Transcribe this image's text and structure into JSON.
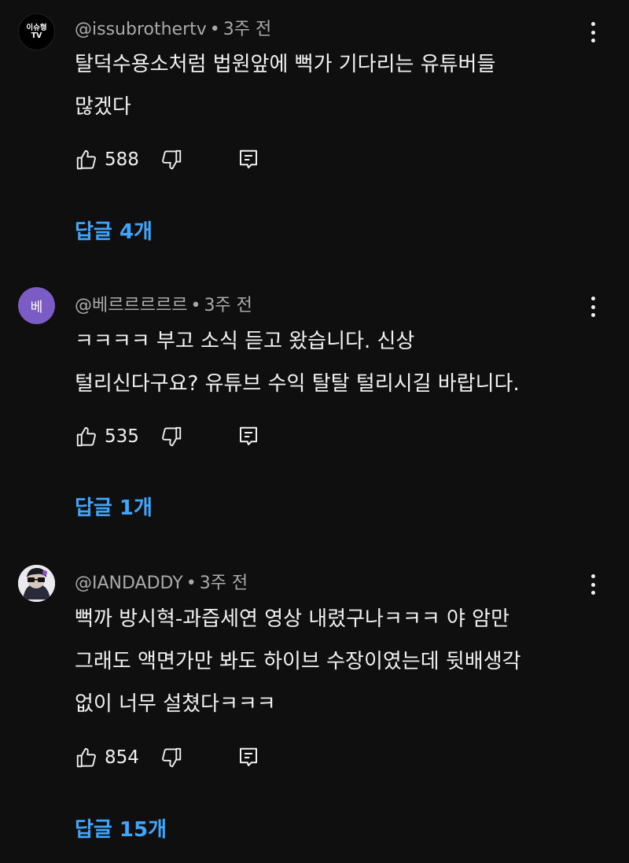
{
  "comments": [
    {
      "avatar_text_line1": "이슈형",
      "avatar_text_line2": "TV",
      "author": "@issubrothertv",
      "separator": "•",
      "time": "3주 전",
      "lines": [
        "탈덕수용소처럼 법원앞에 뻑가 기다리는 유튜버들",
        "많겠다"
      ],
      "likes": "588",
      "replies": "답글 4개"
    },
    {
      "avatar_text": "베",
      "author": "@베르르르르르",
      "separator": "•",
      "time": "3주 전",
      "lines": [
        "ㅋㅋㅋㅋ 부고 소식 듣고 왔습니다. 신상",
        "털리신다구요? 유튜브 수익 탈탈 털리시길 바랍니다."
      ],
      "likes": "535",
      "replies": "답글 1개"
    },
    {
      "author": "@IANDADDY",
      "separator": "•",
      "time": "3주 전",
      "lines": [
        "뻑까 방시혁-과즙세연 영상 내렸구나ㅋㅋㅋ 야 암만",
        "그래도 액면가만 봐도 하이브 수장이였는데 뒷배생각",
        "없이 너무 설쳤다ㅋㅋㅋ"
      ],
      "likes": "854",
      "replies": "답글 15개"
    }
  ],
  "icons": {
    "like": "thumbs-up-icon",
    "dislike": "thumbs-down-icon",
    "reply": "reply-comment-icon",
    "more": "more-vertical-icon"
  },
  "colors": {
    "background": "#0f0f0f",
    "text": "#f1f1f1",
    "meta": "#aaaaaa",
    "link": "#3ea6ff",
    "avatar_purple": "#7b5cc4"
  }
}
